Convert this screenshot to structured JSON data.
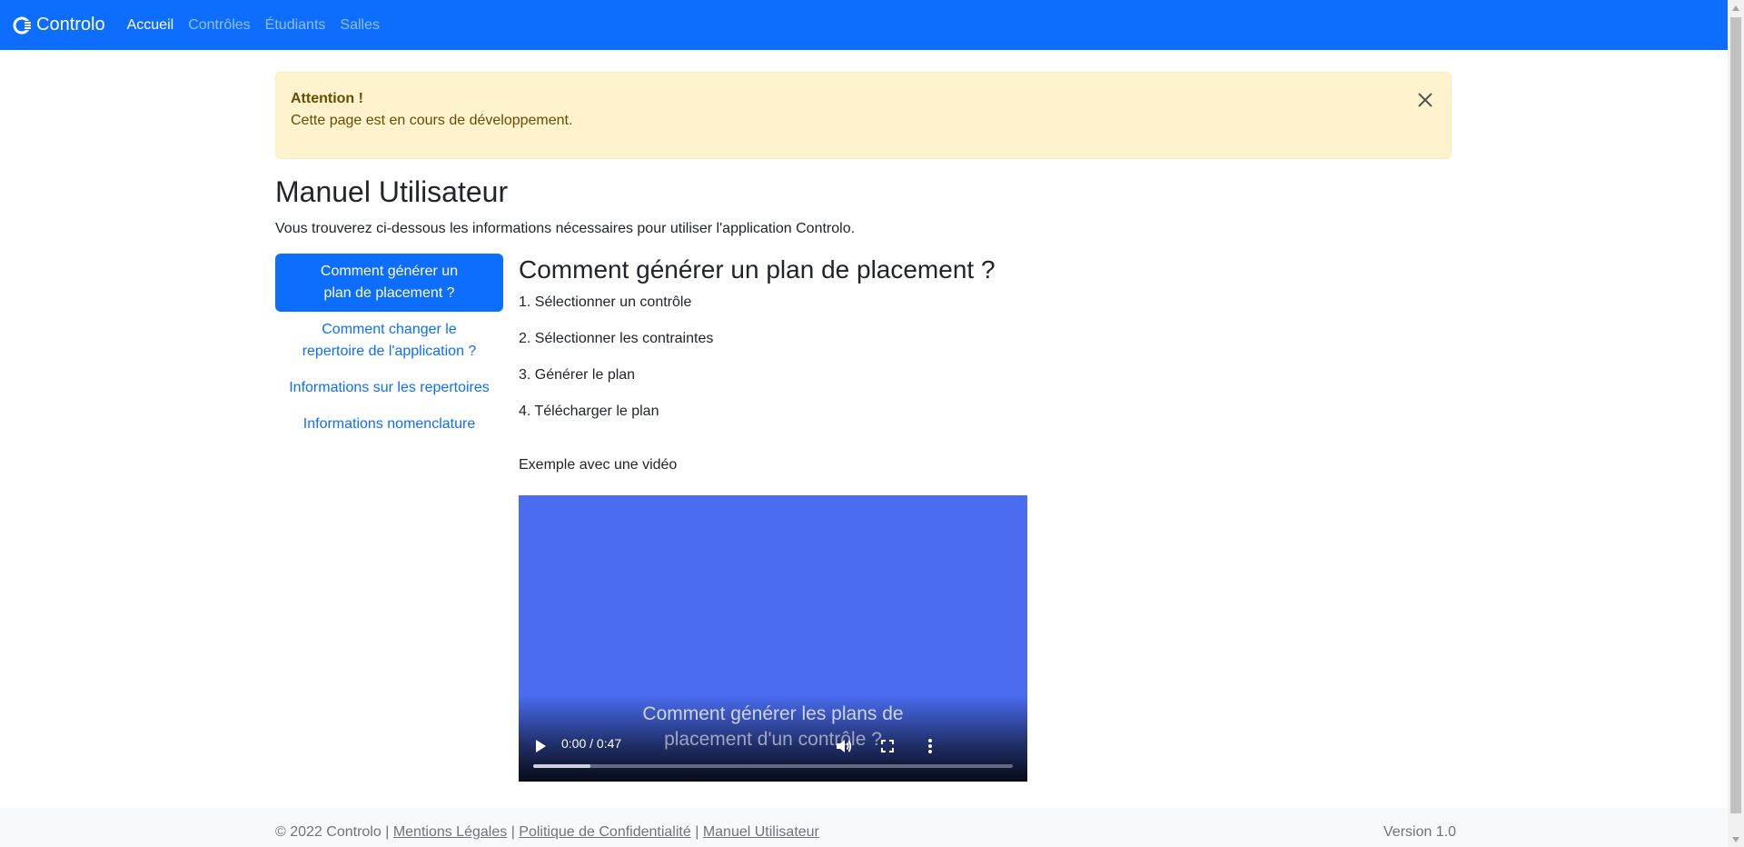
{
  "navbar": {
    "brand": "Controlo",
    "links": [
      {
        "label": "Accueil",
        "active": true
      },
      {
        "label": "Contrôles",
        "active": false
      },
      {
        "label": "Étudiants",
        "active": false
      },
      {
        "label": "Salles",
        "active": false
      }
    ],
    "background": "#0d6efd"
  },
  "alert": {
    "title": "Attention !",
    "text": "Cette page est en cours de développement.",
    "close_icon": "close-icon"
  },
  "page": {
    "title": "Manuel Utilisateur",
    "intro": "Vous trouverez ci-dessous les informations nécessaires pour utiliser l'application Controlo."
  },
  "sidebar": {
    "items": [
      {
        "line1": "Comment générer un",
        "line2": "plan de placement ?",
        "active": true
      },
      {
        "line1": "Comment changer le",
        "line2": "repertoire de l'application ?",
        "active": false
      },
      {
        "line1": "Informations sur les repertoires",
        "line2": "",
        "active": false
      },
      {
        "line1": "Informations nomenclature",
        "line2": "",
        "active": false
      }
    ]
  },
  "content": {
    "title": "Comment générer un plan de placement ?",
    "steps": [
      "1. Sélectionner un contrôle",
      "2. Sélectionner les contraintes",
      "3. Générer le plan",
      "4. Télécharger le plan"
    ],
    "example_label": "Exemple avec une vidéo"
  },
  "video": {
    "caption_line1": "Comment générer les plans de",
    "caption_line2": "placement d'un contrôle ?",
    "time": "0:00 / 0:47",
    "buffered_fraction": 0.12,
    "background": "#4a6cf0",
    "icons": [
      "play-icon",
      "volume-icon",
      "fullscreen-icon",
      "more-options-icon"
    ]
  },
  "footer": {
    "copyright": "© 2022 Controlo |",
    "sep": "|",
    "links": [
      "Mentions Légales",
      "Politique de Confidentialité",
      "Manuel Utilisateur"
    ],
    "version": "Version 1.0"
  }
}
